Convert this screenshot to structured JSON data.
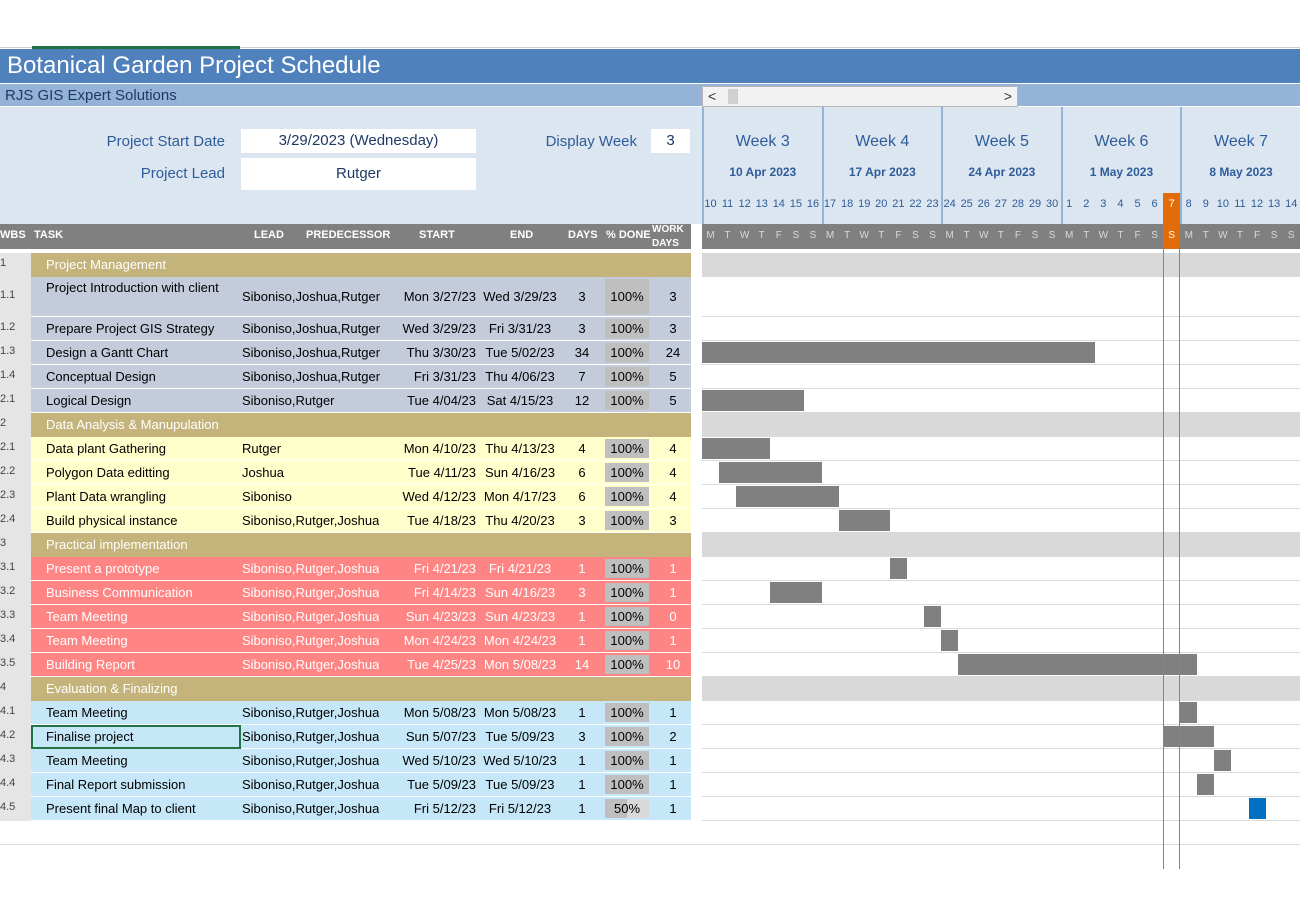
{
  "title": "Botanical Garden Project Schedule",
  "company": "RJS GIS Expert Solutions",
  "start_label": "Project Start Date",
  "start_value": "3/29/2023 (Wednesday)",
  "lead_label": "Project Lead",
  "lead_value": "Rutger",
  "display_week_label": "Display Week",
  "display_week_value": "3",
  "scroll_left": "<",
  "scroll_right": ">",
  "weeks": [
    {
      "name": "Week 3",
      "date": "10 Apr 2023"
    },
    {
      "name": "Week 4",
      "date": "17 Apr 2023"
    },
    {
      "name": "Week 5",
      "date": "24 Apr 2023"
    },
    {
      "name": "Week 6",
      "date": "1 May 2023"
    },
    {
      "name": "Week 7",
      "date": "8 May 2023"
    }
  ],
  "days": [
    "10",
    "11",
    "12",
    "13",
    "14",
    "15",
    "16",
    "17",
    "18",
    "19",
    "20",
    "21",
    "22",
    "23",
    "24",
    "25",
    "26",
    "27",
    "28",
    "29",
    "30",
    "1",
    "2",
    "3",
    "4",
    "5",
    "6",
    "7",
    "8",
    "9",
    "10",
    "11",
    "12",
    "13",
    "14"
  ],
  "day_letters": [
    "M",
    "T",
    "W",
    "T",
    "F",
    "S",
    "S",
    "M",
    "T",
    "W",
    "T",
    "F",
    "S",
    "S",
    "M",
    "T",
    "W",
    "T",
    "F",
    "S",
    "S",
    "M",
    "T",
    "W",
    "T",
    "F",
    "S",
    "S",
    "M",
    "T",
    "W",
    "T",
    "F",
    "S",
    "S"
  ],
  "today_index": 27,
  "headers": {
    "wbs": "WBS",
    "task": "TASK",
    "lead": "LEAD",
    "pred": "PREDECESSOR",
    "start": "START",
    "end": "END",
    "days": "DAYS",
    "done": "% DONE",
    "work": "WORK DAYS"
  },
  "colors": {
    "g1": "#c4ccdc",
    "g2": "#ffffcc",
    "g3": "#ff8585",
    "g4": "#c6e7f8",
    "section": "#c4b37a",
    "bar": "#808080",
    "bar_active": "#0070c0",
    "accent": "#e26b0a",
    "header": "#4f81bd"
  },
  "rows": [
    {
      "type": "section",
      "wbs": "1",
      "task": "Project Management"
    },
    {
      "type": "task",
      "group": "g1",
      "wbs": "1.1",
      "task": "Project Introduction with client",
      "lead": "Siboniso,Joshua,Rutger",
      "start": "Mon 3/27/23",
      "end": "Wed 3/29/23",
      "days": "3",
      "done": "100%",
      "work": "3",
      "progress": 1,
      "bar_start": -1,
      "bar_len": 0
    },
    {
      "type": "task",
      "group": "g1",
      "wbs": "1.2",
      "task": "Prepare Project GIS Strategy",
      "lead": "Siboniso,Joshua,Rutger",
      "start": "Wed 3/29/23",
      "end": "Fri 3/31/23",
      "days": "3",
      "done": "100%",
      "work": "3",
      "progress": 1,
      "bar_start": -1,
      "bar_len": 0
    },
    {
      "type": "task",
      "group": "g1",
      "wbs": "1.3",
      "task": "Design a Gantt Chart",
      "lead": "Siboniso,Joshua,Rutger",
      "start": "Thu 3/30/23",
      "end": "Tue 5/02/23",
      "days": "34",
      "done": "100%",
      "work": "24",
      "progress": 1,
      "bar_start": 0,
      "bar_len": 23
    },
    {
      "type": "task",
      "group": "g1",
      "wbs": "1.4",
      "task": "Conceptual Design",
      "lead": "Siboniso,Joshua,Rutger",
      "start": "Fri 3/31/23",
      "end": "Thu 4/06/23",
      "days": "7",
      "done": "100%",
      "work": "5",
      "progress": 1,
      "bar_start": -1,
      "bar_len": 0
    },
    {
      "type": "task",
      "group": "g1",
      "wbs": "2.1",
      "task": "Logical Design",
      "lead": "Siboniso,Rutger",
      "start": "Tue 4/04/23",
      "end": "Sat 4/15/23",
      "days": "12",
      "done": "100%",
      "work": "5",
      "progress": 1,
      "bar_start": 0,
      "bar_len": 6
    },
    {
      "type": "section",
      "wbs": "2",
      "task": "Data Analysis & Manupulation"
    },
    {
      "type": "task",
      "group": "g2",
      "wbs": "2.1",
      "task": "Data plant Gathering",
      "lead": "Rutger",
      "start": "Mon 4/10/23",
      "end": "Thu 4/13/23",
      "days": "4",
      "done": "100%",
      "work": "4",
      "progress": 1,
      "bar_start": 0,
      "bar_len": 4
    },
    {
      "type": "task",
      "group": "g2",
      "wbs": "2.2",
      "task": "Polygon Data editting",
      "lead": "Joshua",
      "start": "Tue 4/11/23",
      "end": "Sun 4/16/23",
      "days": "6",
      "done": "100%",
      "work": "4",
      "progress": 1,
      "bar_start": 1,
      "bar_len": 6
    },
    {
      "type": "task",
      "group": "g2",
      "wbs": "2.3",
      "task": "Plant Data wrangling",
      "lead": "Siboniso",
      "start": "Wed 4/12/23",
      "end": "Mon 4/17/23",
      "days": "6",
      "done": "100%",
      "work": "4",
      "progress": 1,
      "bar_start": 2,
      "bar_len": 6
    },
    {
      "type": "task",
      "group": "g2",
      "wbs": "2.4",
      "task": "Build physical instance",
      "lead": "Siboniso,Rutger,Joshua",
      "start": "Tue 4/18/23",
      "end": "Thu 4/20/23",
      "days": "3",
      "done": "100%",
      "work": "3",
      "progress": 1,
      "bar_start": 8,
      "bar_len": 3
    },
    {
      "type": "section",
      "wbs": "3",
      "task": "Practical implementation"
    },
    {
      "type": "task",
      "group": "g3",
      "wbs": "3.1",
      "task": "Present a prototype",
      "lead": "Siboniso,Rutger,Joshua",
      "start": "Fri 4/21/23",
      "end": "Fri 4/21/23",
      "days": "1",
      "done": "100%",
      "work": "1",
      "progress": 1,
      "bar_start": 11,
      "bar_len": 1
    },
    {
      "type": "task",
      "group": "g3",
      "wbs": "3.2",
      "task": "Business Communication",
      "lead": "Siboniso,Rutger,Joshua",
      "start": "Fri 4/14/23",
      "end": "Sun 4/16/23",
      "days": "3",
      "done": "100%",
      "work": "1",
      "progress": 1,
      "bar_start": 4,
      "bar_len": 3
    },
    {
      "type": "task",
      "group": "g3",
      "wbs": "3.3",
      "task": "Team Meeting",
      "lead": "Siboniso,Rutger,Joshua",
      "start": "Sun 4/23/23",
      "end": "Sun 4/23/23",
      "days": "1",
      "done": "100%",
      "work": "0",
      "progress": 1,
      "bar_start": 13,
      "bar_len": 1
    },
    {
      "type": "task",
      "group": "g3",
      "wbs": "3.4",
      "task": "Team Meeting",
      "lead": "Siboniso,Rutger,Joshua",
      "start": "Mon 4/24/23",
      "end": "Mon 4/24/23",
      "days": "1",
      "done": "100%",
      "work": "1",
      "progress": 1,
      "bar_start": 14,
      "bar_len": 1
    },
    {
      "type": "task",
      "group": "g3",
      "wbs": "3.5",
      "task": "Building Report",
      "lead": "Siboniso,Rutger,Joshua",
      "start": "Tue 4/25/23",
      "end": "Mon 5/08/23",
      "days": "14",
      "done": "100%",
      "work": "10",
      "progress": 1,
      "bar_start": 15,
      "bar_len": 14
    },
    {
      "type": "section",
      "wbs": "4",
      "task": "Evaluation & Finalizing"
    },
    {
      "type": "task",
      "group": "g4",
      "wbs": "4.1",
      "task": "Team Meeting",
      "lead": "Siboniso,Rutger,Joshua",
      "start": "Mon 5/08/23",
      "end": "Mon 5/08/23",
      "days": "1",
      "done": "100%",
      "work": "1",
      "progress": 1,
      "bar_start": 28,
      "bar_len": 1
    },
    {
      "type": "task",
      "group": "g4",
      "wbs": "4.2",
      "task": "Finalise project",
      "lead": "Siboniso,Rutger,Joshua",
      "start": "Sun 5/07/23",
      "end": "Tue 5/09/23",
      "days": "3",
      "done": "100%",
      "work": "2",
      "progress": 1,
      "bar_start": 27,
      "bar_len": 3,
      "selected": true
    },
    {
      "type": "task",
      "group": "g4",
      "wbs": "4.3",
      "task": "Team Meeting",
      "lead": "Siboniso,Rutger,Joshua",
      "start": "Wed 5/10/23",
      "end": "Wed 5/10/23",
      "days": "1",
      "done": "100%",
      "work": "1",
      "progress": 1,
      "bar_start": 30,
      "bar_len": 1
    },
    {
      "type": "task",
      "group": "g4",
      "wbs": "4.4",
      "task": "Final Report submission",
      "lead": "Siboniso,Rutger,Joshua",
      "start": "Tue 5/09/23",
      "end": "Tue 5/09/23",
      "days": "1",
      "done": "100%",
      "work": "1",
      "progress": 1,
      "bar_start": 29,
      "bar_len": 1
    },
    {
      "type": "task",
      "group": "g4",
      "wbs": "4.5",
      "task": "Present final Map to client",
      "lead": "Siboniso,Rutger,Joshua",
      "start": "Fri 5/12/23",
      "end": "Fri 5/12/23",
      "days": "1",
      "done": "50%",
      "work": "1",
      "progress": 0.5,
      "bar_start": 32,
      "bar_len": 1,
      "active": true
    }
  ]
}
